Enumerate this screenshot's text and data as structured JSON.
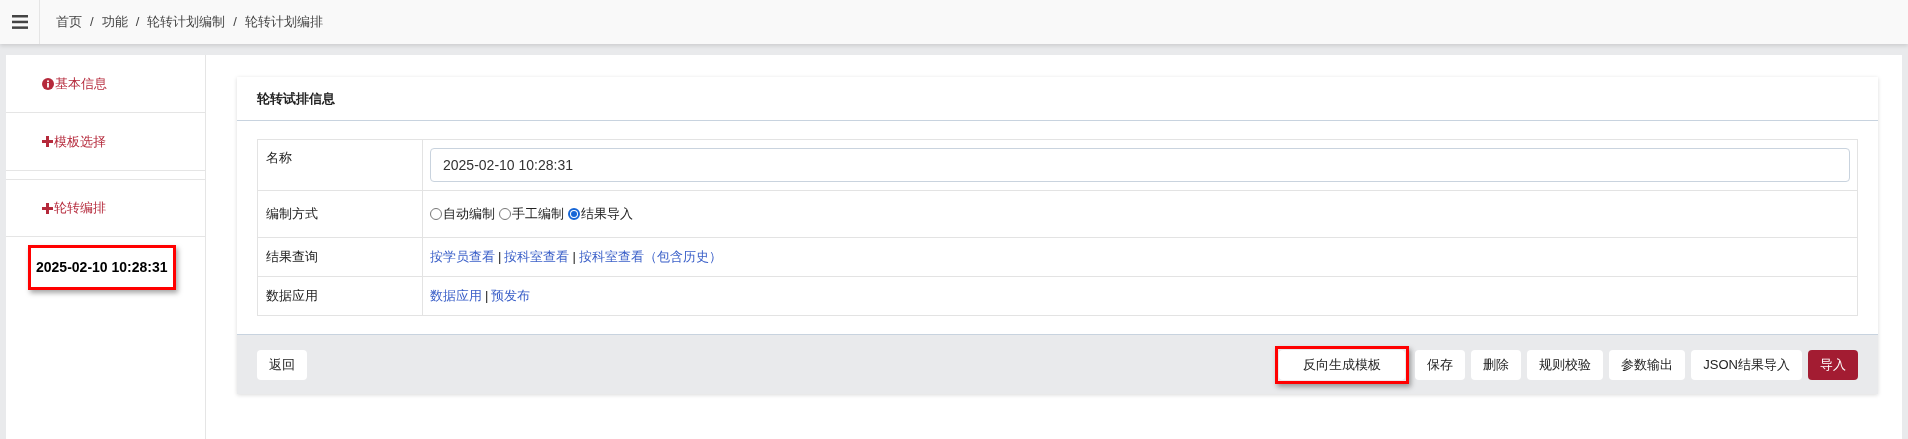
{
  "breadcrumb": {
    "separator": "/",
    "items": [
      "首页",
      "功能",
      "轮转计划编制",
      "轮转计划编排"
    ]
  },
  "sidebar": {
    "items": [
      {
        "kind": "info",
        "label": "基本信息",
        "highlighted": false
      },
      {
        "kind": "add",
        "label": "模板选择",
        "highlighted": false
      },
      {
        "kind": "add",
        "label": "轮转编排",
        "highlighted": false
      },
      {
        "kind": "record",
        "label": "2025-02-10 10:28:31",
        "highlighted": true
      }
    ]
  },
  "card": {
    "title": "轮转试排信息",
    "rows": [
      {
        "kind": "input",
        "label": "名称",
        "value": "2025-02-10 10:28:31"
      },
      {
        "kind": "radio",
        "label": "编制方式",
        "options": [
          {
            "label": "自动编制",
            "selected": false
          },
          {
            "label": "手工编制",
            "selected": false
          },
          {
            "label": "结果导入",
            "selected": true
          }
        ]
      },
      {
        "kind": "links",
        "label": "结果查询",
        "separator": "|",
        "links": [
          "按学员查看",
          "按科室查看",
          "按科室查看（包含历史）"
        ]
      },
      {
        "kind": "links",
        "label": "数据应用",
        "separator": "|",
        "links": [
          "数据应用",
          "预发布"
        ]
      }
    ]
  },
  "footer": {
    "left_buttons": [
      {
        "label": "返回",
        "primary": false,
        "highlighted": false
      }
    ],
    "right_buttons": [
      {
        "label": "反向生成模板",
        "primary": false,
        "highlighted": true
      },
      {
        "label": "保存",
        "primary": false,
        "highlighted": false
      },
      {
        "label": "删除",
        "primary": false,
        "highlighted": false
      },
      {
        "label": "规则校验",
        "primary": false,
        "highlighted": false
      },
      {
        "label": "参数输出",
        "primary": false,
        "highlighted": false
      },
      {
        "label": "JSON结果导入",
        "primary": false,
        "highlighted": false
      },
      {
        "label": "导入",
        "primary": true,
        "highlighted": false
      }
    ]
  }
}
